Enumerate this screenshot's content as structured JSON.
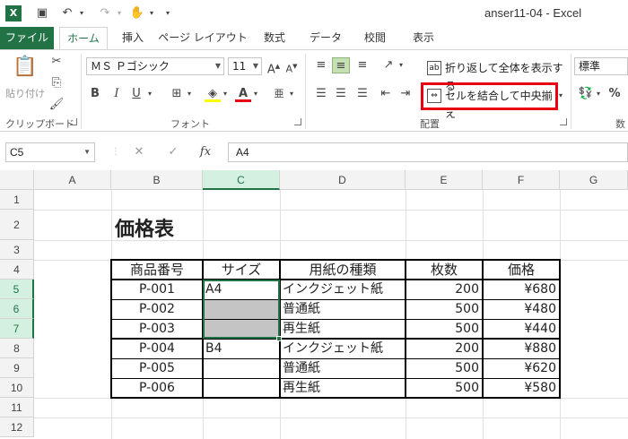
{
  "window": {
    "title": "anser11-04 - Excel"
  },
  "tabs": [
    "ファイル",
    "ホーム",
    "挿入",
    "ページ レイアウト",
    "数式",
    "データ",
    "校閲",
    "表示"
  ],
  "ribbon": {
    "clipboard": {
      "paste_label": "貼り付け",
      "group_label": "クリップボード"
    },
    "font": {
      "name": "ＭＳ Ｐゴシック",
      "size": "11",
      "group_label": "フォント"
    },
    "alignment": {
      "wrap_label": "折り返して全体を表示する",
      "merge_label": "セルを結合して中央揃え",
      "group_label": "配置"
    },
    "number": {
      "format": "標準",
      "group_label": "数"
    }
  },
  "formula_bar": {
    "name_box": "C5",
    "content": "A4",
    "fx": "fx"
  },
  "grid": {
    "columns": [
      "A",
      "B",
      "C",
      "D",
      "E",
      "F",
      "G"
    ],
    "rows": [
      "1",
      "2",
      "3",
      "4",
      "5",
      "6",
      "7",
      "8",
      "9",
      "10",
      "11",
      "12"
    ]
  },
  "sheet": {
    "title": "価格表",
    "headers": [
      "商品番号",
      "サイズ",
      "用紙の種類",
      "枚数",
      "価格"
    ],
    "rows": [
      [
        "P-001",
        "A4",
        "インクジェット紙",
        "200",
        "¥680"
      ],
      [
        "P-002",
        "",
        "普通紙",
        "500",
        "¥480"
      ],
      [
        "P-003",
        "",
        "再生紙",
        "500",
        "¥440"
      ],
      [
        "P-004",
        "B4",
        "インクジェット紙",
        "200",
        "¥880"
      ],
      [
        "P-005",
        "",
        "普通紙",
        "500",
        "¥620"
      ],
      [
        "P-006",
        "",
        "再生紙",
        "500",
        "¥580"
      ]
    ]
  },
  "colors": {
    "excel_green": "#217346",
    "highlight_red": "#e60012",
    "selection_gray": "#c4c4c4"
  }
}
